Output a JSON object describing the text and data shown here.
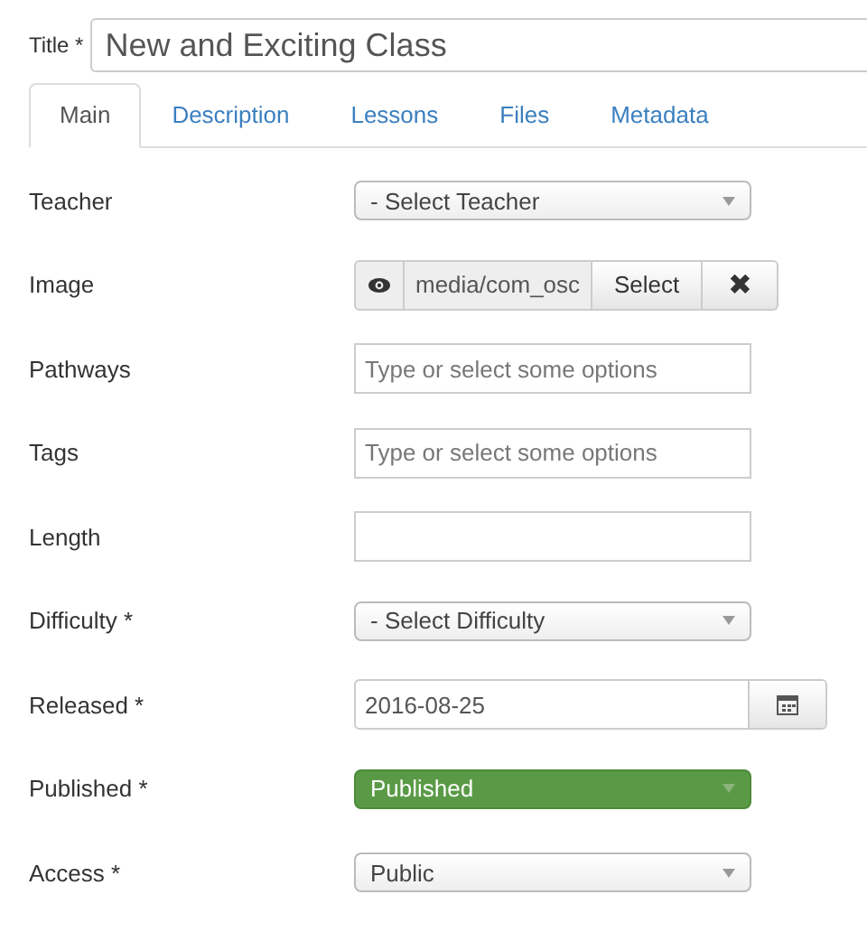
{
  "title_field": {
    "label": "Title *",
    "value": "New and Exciting Class"
  },
  "tabs": [
    {
      "label": "Main",
      "selected": true
    },
    {
      "label": "Description",
      "selected": false
    },
    {
      "label": "Lessons",
      "selected": false
    },
    {
      "label": "Files",
      "selected": false
    },
    {
      "label": "Metadata",
      "selected": false
    }
  ],
  "fields": [
    {
      "label": "Teacher",
      "kind": "select",
      "value": "- Select Teacher"
    },
    {
      "label": "Image",
      "kind": "media",
      "value": "media/com_osc",
      "button": "Select",
      "clear": "✖"
    },
    {
      "label": "Pathways",
      "kind": "text",
      "placeholder": "Type or select some options"
    },
    {
      "label": "Tags",
      "kind": "text",
      "placeholder": "Type or select some options"
    },
    {
      "label": "Length",
      "kind": "text"
    },
    {
      "label": "Difficulty *",
      "kind": "select",
      "value": "- Select Difficulty"
    },
    {
      "label": "Released *",
      "kind": "date",
      "value": "2016-08-25"
    },
    {
      "label": "Published *",
      "kind": "status",
      "value": "Published"
    },
    {
      "label": "Access *",
      "kind": "select",
      "value": "Public"
    }
  ]
}
